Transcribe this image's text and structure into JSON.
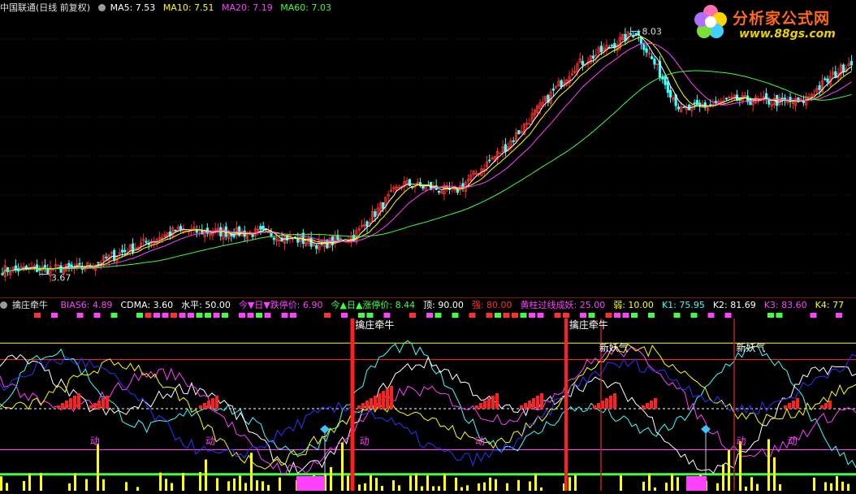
{
  "header": {
    "stock_name": "中国联通(日线 前复权)",
    "ma5": "MA5: 7.53",
    "ma10": "MA10: 7.51",
    "ma20": "MA20: 7.19",
    "ma60": "MA60: 7.03",
    "colors": {
      "ma5": "#ffffff",
      "ma10": "#ffff00",
      "ma20": "#ff40ff",
      "ma60": "#40ff40"
    }
  },
  "logo": {
    "title": "分析家公式网",
    "url": "www.88gs.com"
  },
  "indicator_header": {
    "name": "擒庄牵牛",
    "items": [
      {
        "text": "BIAS6: 4.89",
        "color": "#ff40ff"
      },
      {
        "text": "CDMA: 3.60",
        "color": "#ffffff"
      },
      {
        "text": "水平: 50.00",
        "color": "#ffffff"
      },
      {
        "text": "今▼日▼跌停价: 6.90",
        "color": "#ff40ff"
      },
      {
        "text": "今▲日▲涨停价: 8.44",
        "color": "#40ff40"
      },
      {
        "text": "顶: 90.00",
        "color": "#ffffff"
      },
      {
        "text": "强: 80.00",
        "color": "#ff3030"
      },
      {
        "text": "黄柱过线成妖: 25.00",
        "color": "#ff40ff"
      },
      {
        "text": "弱: 10.00",
        "color": "#ffff00"
      },
      {
        "text": "K1: 75.95",
        "color": "#40ffff"
      },
      {
        "text": "K2: 81.69",
        "color": "#ffffff"
      },
      {
        "text": "K3: 83.60",
        "color": "#ff40ff"
      },
      {
        "text": "K4: 77",
        "color": "#ffff00"
      }
    ]
  },
  "chart_data": [
    {
      "type": "candlestick",
      "title": "中国联通(日线 前复权)",
      "annotations": [
        {
          "text": "8.03",
          "kind": "high"
        },
        {
          "text": "3.67",
          "kind": "low"
        }
      ],
      "ylim": [
        3.4,
        8.3
      ],
      "segments": [
        {
          "from": 0,
          "to": 30,
          "start": 3.75,
          "end": 3.78
        },
        {
          "from": 30,
          "to": 65,
          "start": 3.78,
          "end": 4.45
        },
        {
          "from": 65,
          "to": 100,
          "start": 4.45,
          "end": 4.4
        },
        {
          "from": 100,
          "to": 120,
          "start": 4.4,
          "end": 4.2
        },
        {
          "from": 120,
          "to": 132,
          "start": 4.2,
          "end": 4.35
        },
        {
          "from": 132,
          "to": 150,
          "start": 4.35,
          "end": 5.3
        },
        {
          "from": 150,
          "to": 170,
          "start": 5.3,
          "end": 5.15
        },
        {
          "from": 170,
          "to": 190,
          "start": 5.15,
          "end": 6.0
        },
        {
          "from": 190,
          "to": 215,
          "start": 6.0,
          "end": 7.4
        },
        {
          "from": 215,
          "to": 238,
          "start": 7.4,
          "end": 8.03
        },
        {
          "from": 238,
          "to": 255,
          "start": 8.03,
          "end": 6.6
        },
        {
          "from": 255,
          "to": 275,
          "start": 6.6,
          "end": 6.8
        },
        {
          "from": 275,
          "to": 300,
          "start": 6.8,
          "end": 6.75
        },
        {
          "from": 300,
          "to": 320,
          "start": 6.75,
          "end": 7.55
        }
      ],
      "series": [
        {
          "name": "MA5",
          "color": "#ffffff",
          "window": 5
        },
        {
          "name": "MA10",
          "color": "#ffff00",
          "window": 10
        },
        {
          "name": "MA20",
          "color": "#ff40ff",
          "window": 20
        },
        {
          "name": "MA60",
          "color": "#40ff40",
          "window": 60
        }
      ]
    },
    {
      "type": "line",
      "title": "擒庄牵牛",
      "ylim": [
        0,
        100
      ],
      "levels": [
        {
          "name": "顶",
          "value": 90,
          "color": "#ffff00"
        },
        {
          "name": "强",
          "value": 80,
          "color": "#ff3030"
        },
        {
          "name": "水平",
          "value": 50,
          "color": "#ffffff"
        },
        {
          "name": "黄柱过线成妖",
          "value": 25,
          "color": "#ff40ff"
        },
        {
          "name": "弱",
          "value": 10,
          "color": "#40ff40"
        }
      ],
      "labels": [
        {
          "text": "擒庄牵牛",
          "at": 0.415
        },
        {
          "text": "擒庄牵牛",
          "at": 0.665
        },
        {
          "text": "新妖气",
          "at": 0.7
        },
        {
          "text": "新妖气",
          "at": 0.86
        },
        {
          "text": "动",
          "at": 0.105
        },
        {
          "text": "动",
          "at": 0.24
        },
        {
          "text": "动",
          "at": 0.42
        },
        {
          "text": "动",
          "at": 0.555
        },
        {
          "text": "动",
          "at": 0.86
        },
        {
          "text": "动",
          "at": 0.92
        }
      ]
    }
  ]
}
